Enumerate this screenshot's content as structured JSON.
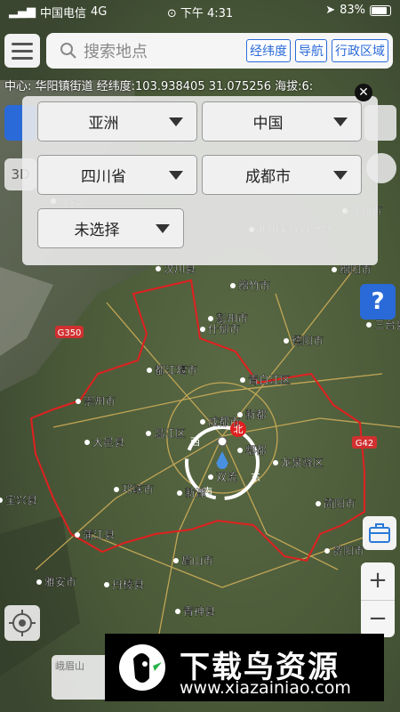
{
  "status_bar": {
    "carrier": "中国电信",
    "network": "4G",
    "time": "下午 4:31",
    "battery": "83%",
    "battery_level": 0.83
  },
  "search": {
    "placeholder": "搜索地点",
    "chips": [
      "经纬度",
      "导航",
      "行政区域"
    ]
  },
  "coordinate_line": "中心: 华阳镇街道 经纬度:103.938405 31.075256 海拔:6:",
  "region_panel": {
    "continent": "亚洲",
    "country": "中国",
    "province": "四川省",
    "city": "成都市",
    "district": "未选择"
  },
  "map": {
    "labels": [
      "汶川县",
      "绵竹市",
      "什邡市",
      "德阳市",
      "绵阳市",
      "三台县",
      "都江堰市",
      "彭州市",
      "青白江区",
      "崇州市",
      "温江区",
      "大邑县",
      "成都市",
      "新都",
      "郫都",
      "龙泉驿区",
      "邛崃市",
      "双流",
      "新津",
      "简阳市",
      "蒲江县",
      "资阳市",
      "眉山市",
      "雅安市",
      "丹棱县",
      "青神县",
      "茂县",
      "北川羌族自治县",
      "江油市",
      "理县",
      "宝兴县"
    ],
    "compass_north": "北",
    "compass_west": "西",
    "compass_south": "南",
    "compass_east": "东",
    "road_badge_1": "G350",
    "road_badge_2": "G42",
    "help_symbol": "?",
    "view_3d": "3D",
    "zoom_in": "+",
    "zoom_out": "−",
    "bottom_card_text": "峨眉山"
  },
  "watermark": {
    "title": "下载鸟资源",
    "url": "www.xiazainiao.com"
  }
}
